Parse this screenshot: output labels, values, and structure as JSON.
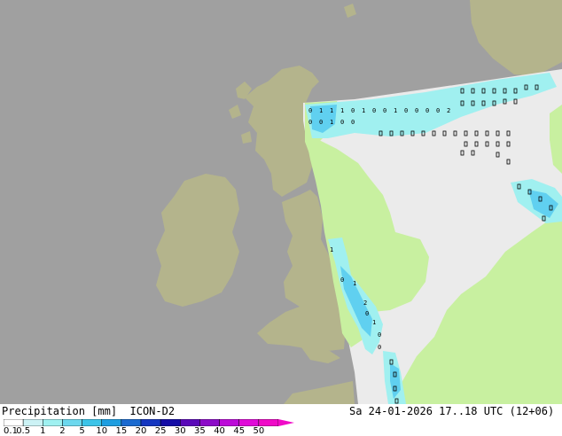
{
  "map": {
    "sea_color": "#a0a0a0",
    "land_outside_color": "#b4b48c",
    "land_domain_color": "#c8f0a0",
    "sea_domain_color": "#ebebeb",
    "precip_light_color": "#a0f0f0",
    "precip_medium_color": "#60d0f0",
    "cell_values": {
      "north_sea": [
        "0",
        "1",
        "1",
        "1",
        "0",
        "1",
        "0",
        "0",
        "1",
        "0",
        "0",
        "0",
        "0",
        "2",
        "0",
        "0",
        "1",
        "0",
        "0"
      ],
      "channel": [
        "1",
        "0",
        "1",
        "2",
        "0",
        "1",
        "0",
        "0"
      ]
    }
  },
  "footer": {
    "title": "Precipitation [mm]  ICON-D2",
    "datetime": "Sa 24-01-2026 17..18 UTC (12+06)"
  },
  "legend": {
    "ticks": [
      "0.1",
      "0.5",
      "1",
      "2",
      "5",
      "10",
      "15",
      "20",
      "25",
      "30",
      "35",
      "40",
      "45",
      "50"
    ],
    "colors": [
      "#ffffff",
      "#ccf2f5",
      "#9ff1f1",
      "#6cd8ee",
      "#3cc4e8",
      "#1e9ee0",
      "#1a6ad0",
      "#1436c0",
      "#140ca6",
      "#5a08b8",
      "#8c0ac8",
      "#bc0ad8",
      "#e00ad8",
      "#f00ac8"
    ]
  }
}
